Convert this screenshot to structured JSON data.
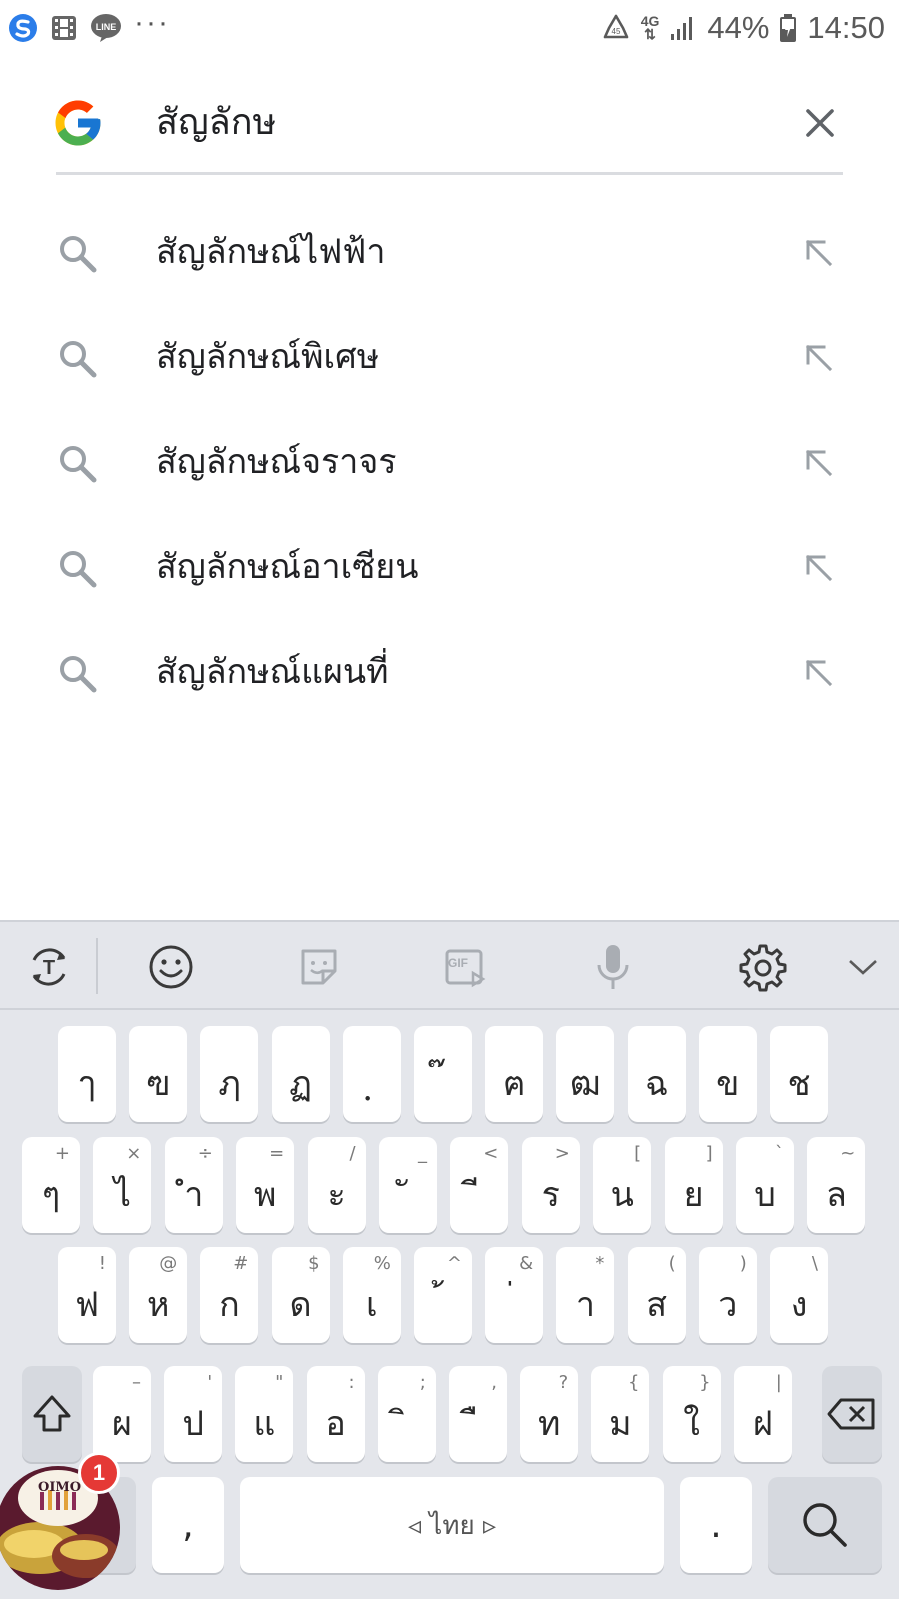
{
  "status_bar": {
    "icons_left": [
      "s-app-icon",
      "film-icon",
      "line-app-icon"
    ],
    "more_label": "···",
    "recycle_icon": "recycle-icon",
    "network_top": "4G",
    "battery_percent": "44%",
    "time": "14:50"
  },
  "search": {
    "logo": "google-g-logo",
    "query": "สัญลักษ",
    "clear_icon": "close-icon"
  },
  "suggestions": [
    {
      "text": "สัญลักษณ์ไฟฟ้า"
    },
    {
      "text": "สัญลักษณ์พิเศษ"
    },
    {
      "text": "สัญลักษณ์จราจร"
    },
    {
      "text": "สัญลักษณ์อาเซียน"
    },
    {
      "text": "สัญลักษณ์แผนที่"
    }
  ],
  "keyboard": {
    "toolbar": [
      "translate-icon",
      "emoji-icon",
      "sticker-icon",
      "gif-icon",
      "mic-icon",
      "settings-icon",
      "collapse-icon"
    ],
    "gif_label": "GIF",
    "row1": [
      {
        "key": "ๅ",
        "hint": ""
      },
      {
        "key": "ฃ",
        "hint": ""
      },
      {
        "key": "ฦ",
        "hint": ""
      },
      {
        "key": "ฏ",
        "hint": ""
      },
      {
        "key": "ฺ",
        "hint": ""
      },
      {
        "key": "๊",
        "hint": ""
      },
      {
        "key": "ฅ",
        "hint": ""
      },
      {
        "key": "ฒ",
        "hint": ""
      },
      {
        "key": "ฉ",
        "hint": ""
      },
      {
        "key": "ข",
        "hint": ""
      },
      {
        "key": "ช",
        "hint": ""
      }
    ],
    "row2": [
      {
        "key": "ๆ",
        "hint": "+"
      },
      {
        "key": "ไ",
        "hint": "×"
      },
      {
        "key": "ำ",
        "hint": "÷"
      },
      {
        "key": "พ",
        "hint": "="
      },
      {
        "key": "ะ",
        "hint": "/"
      },
      {
        "key": "ั",
        "hint": "_"
      },
      {
        "key": "ี",
        "hint": "<"
      },
      {
        "key": "ร",
        "hint": ">"
      },
      {
        "key": "น",
        "hint": "["
      },
      {
        "key": "ย",
        "hint": "]"
      },
      {
        "key": "บ",
        "hint": "`"
      },
      {
        "key": "ล",
        "hint": "~"
      }
    ],
    "row3": [
      {
        "key": "ฟ",
        "hint": "!"
      },
      {
        "key": "ห",
        "hint": "@"
      },
      {
        "key": "ก",
        "hint": "#"
      },
      {
        "key": "ด",
        "hint": "$"
      },
      {
        "key": "เ",
        "hint": "%"
      },
      {
        "key": "้",
        "hint": "^"
      },
      {
        "key": "่",
        "hint": "&"
      },
      {
        "key": "า",
        "hint": "*"
      },
      {
        "key": "ส",
        "hint": "("
      },
      {
        "key": "ว",
        "hint": ")"
      },
      {
        "key": "ง",
        "hint": "\\"
      }
    ],
    "row4": [
      {
        "key": "ผ",
        "hint": "–"
      },
      {
        "key": "ป",
        "hint": "'"
      },
      {
        "key": "แ",
        "hint": "\""
      },
      {
        "key": "อ",
        "hint": ":"
      },
      {
        "key": "ิ",
        "hint": ";"
      },
      {
        "key": "ื",
        "hint": ","
      },
      {
        "key": "ท",
        "hint": "?"
      },
      {
        "key": "ม",
        "hint": "{"
      },
      {
        "key": "ใ",
        "hint": "}"
      },
      {
        "key": "ฝ",
        "hint": "|"
      }
    ],
    "comma": ",",
    "space_label": "◃ ไทย ▹",
    "period": ".",
    "shift_icon": "shift-icon",
    "backspace_icon": "backspace-icon",
    "search_icon": "search-icon"
  },
  "bubble": {
    "logo_text": "OIMO",
    "badge": "1"
  }
}
